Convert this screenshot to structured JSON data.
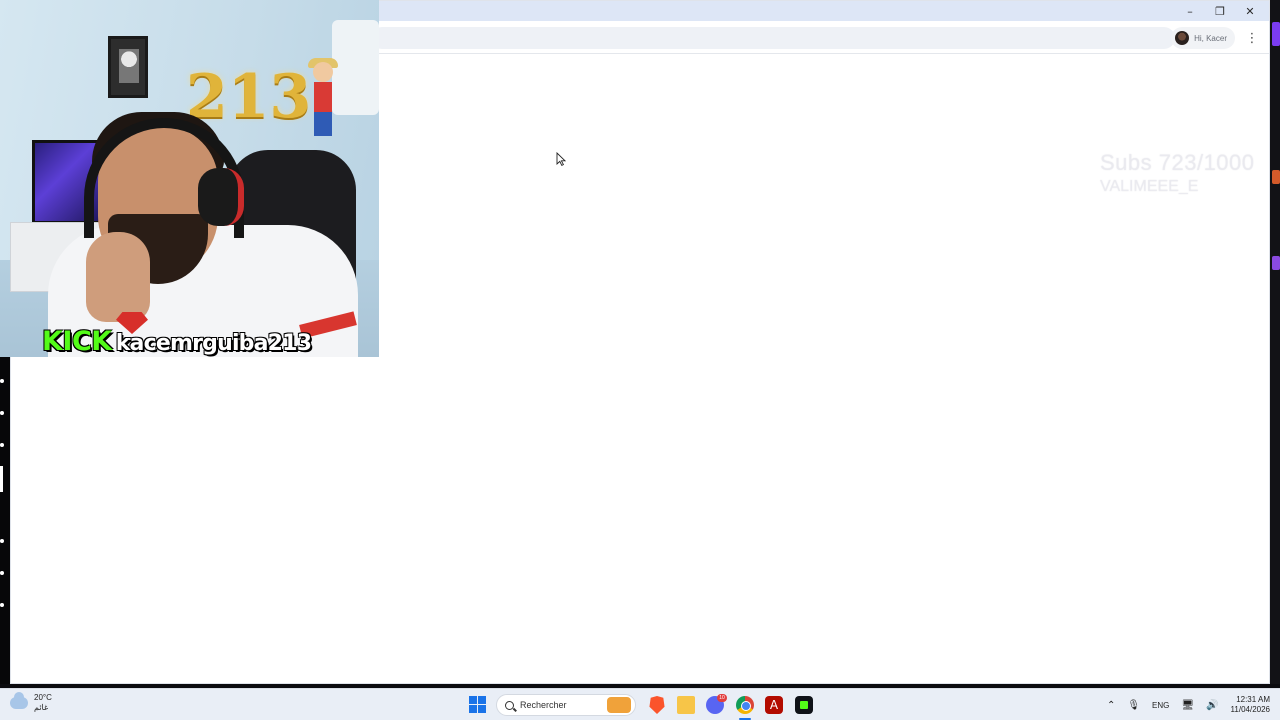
{
  "browser": {
    "profile_greeting": "Hi, Kacer",
    "window_controls": {
      "minimize": "–",
      "restore": "❐",
      "close": "✕"
    },
    "menu_glyph": "⋮"
  },
  "overlay": {
    "watermark_line1": "Subs 723/1000",
    "watermark_line2": "VALIMEEE_E"
  },
  "webcam": {
    "balloon_text": "213",
    "kick_logo": "KICK",
    "kick_username": "kacemrguiba213"
  },
  "taskbar": {
    "weather_temp": "20°C",
    "weather_label": "غائم",
    "search_placeholder": "Rechercher",
    "acrobat_glyph": "A",
    "discord_badge": "10",
    "tray_chevron": "⌃",
    "tray_mic": "🎙",
    "language": "ENG",
    "tray_network": "🖥",
    "tray_volume": "🔊",
    "time": "12:31 AM",
    "date": "11/04/2026"
  },
  "colors": {
    "kick_green": "#53fc18",
    "accent_purple": "#7b3cf2",
    "titlebar": "#dde6f6",
    "taskbar": "#e9eef6"
  },
  "icons": [
    "start-icon",
    "search-icon",
    "brave-icon",
    "file-explorer-icon",
    "discord-icon",
    "chrome-icon",
    "acrobat-icon",
    "kick-icon",
    "weather-icon",
    "mouse-cursor-icon"
  ]
}
